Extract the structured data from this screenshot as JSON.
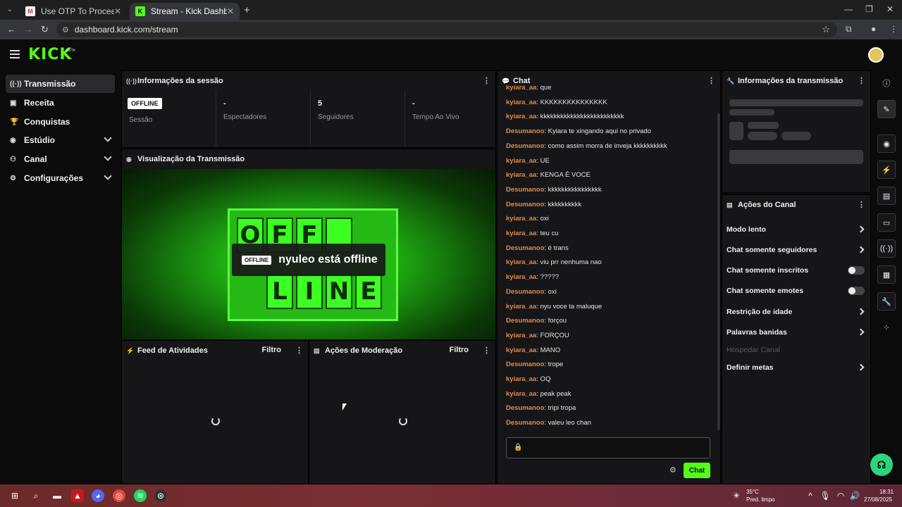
{
  "browser": {
    "tabs": [
      {
        "title": "Use OTP To Proceed - nyuleojo",
        "favicon": "gmail-icon"
      },
      {
        "title": "Stream - Kick Dashboard",
        "favicon": "kick-icon"
      }
    ],
    "url": "dashboard.kick.com/stream"
  },
  "header": {
    "logo": "KICK",
    "beta": "BETA"
  },
  "sidebar": {
    "items": [
      {
        "label": "Transmissão",
        "icon": "broadcast-icon",
        "active": true
      },
      {
        "label": "Receita",
        "icon": "wallet-icon"
      },
      {
        "label": "Conquistas",
        "icon": "trophy-icon"
      },
      {
        "label": "Estúdio",
        "icon": "studio-icon",
        "expandable": true
      },
      {
        "label": "Canal",
        "icon": "channel-icon",
        "expandable": true
      },
      {
        "label": "Configurações",
        "icon": "gear-icon",
        "expandable": true
      }
    ]
  },
  "session": {
    "title": "Informações da sessão",
    "badge": "OFFLINE",
    "stats": [
      {
        "value": "",
        "label": "Sessão"
      },
      {
        "value": "-",
        "label": "Espectadores"
      },
      {
        "value": "5",
        "label": "Seguidores"
      },
      {
        "value": "-",
        "label": "Tempo Ao Vivo"
      }
    ]
  },
  "preview": {
    "title": "Visualização da Transmissão",
    "badge": "OFFLINE",
    "message": "nyuleo está offline",
    "sign_letters": [
      "O",
      "F",
      "F",
      "",
      "L",
      "I",
      "N",
      "E"
    ]
  },
  "activity": {
    "title": "Feed de Atividades",
    "filter": "Filtro"
  },
  "moderation": {
    "title": "Ações de Moderação",
    "filter": "Filtro"
  },
  "chat": {
    "title": "Chat",
    "send_label": "Chat",
    "messages": [
      {
        "user": "kyiara_aa",
        "text": "que"
      },
      {
        "user": "kyiara_aa",
        "text": "KKKKKKKKKKKKKKK"
      },
      {
        "user": "kyiara_aa",
        "text": "kkkkkkkkkkkkkkkkkkkkkkkkk"
      },
      {
        "user": "Desumanoo",
        "text": "Kyiara te xingando aqui no privado"
      },
      {
        "user": "Desumanoo",
        "text": "como assim morra de inveja kkkkkkkkkk"
      },
      {
        "user": "kyiara_aa",
        "text": "UE"
      },
      {
        "user": "kyiara_aa",
        "text": "KENGA É VOCE"
      },
      {
        "user": "Desumanoo",
        "text": "kkkkkkkkkkkkkkkk"
      },
      {
        "user": "Desumanoo",
        "text": "kkkkkkkkkk"
      },
      {
        "user": "kyiara_aa",
        "text": "oxi"
      },
      {
        "user": "kyiara_aa",
        "text": "teu cu"
      },
      {
        "user": "Desumanoo",
        "text": "é trans"
      },
      {
        "user": "kyiara_aa",
        "text": "viu prr nenhuma nao"
      },
      {
        "user": "kyiara_aa",
        "text": "?????"
      },
      {
        "user": "Desumanoo",
        "text": "oxi"
      },
      {
        "user": "kyiara_aa",
        "text": "nyu voce ta maluque"
      },
      {
        "user": "Desumanoo",
        "text": "forçou"
      },
      {
        "user": "kyiara_aa",
        "text": "FORÇOU"
      },
      {
        "user": "kyiara_aa",
        "text": "MANO"
      },
      {
        "user": "Desumanoo",
        "text": "trope"
      },
      {
        "user": "kyiara_aa",
        "text": "OQ"
      },
      {
        "user": "kyiara_aa",
        "text": "peak peak"
      },
      {
        "user": "Desumanoo",
        "text": "tripi tropa"
      },
      {
        "user": "Desumanoo",
        "text": "valeu leo chan"
      }
    ]
  },
  "stream_info": {
    "title": "Informações da transmissão"
  },
  "channel_actions": {
    "title": "Ações do Canal",
    "items": [
      {
        "label": "Modo lento",
        "control": "arrow"
      },
      {
        "label": "Chat somente seguidores",
        "control": "arrow"
      },
      {
        "label": "Chat somente inscritos",
        "control": "toggle",
        "on": false
      },
      {
        "label": "Chat somente emotes",
        "control": "toggle",
        "on": false
      },
      {
        "label": "Restrição de idade",
        "control": "arrow"
      },
      {
        "label": "Palavras banidas",
        "control": "arrow"
      },
      {
        "label": "Hospedar Canal",
        "control": "none",
        "disabled": true
      },
      {
        "label": "Definir metas",
        "control": "arrow"
      }
    ]
  },
  "taskbar": {
    "weather_temp": "35°C",
    "weather_desc": "Pred. limpo",
    "time": "18:31",
    "date": "27/08/2025"
  },
  "colors": {
    "accent": "#53fc18",
    "username": "#e08b4e",
    "help": "#2dd47a"
  }
}
